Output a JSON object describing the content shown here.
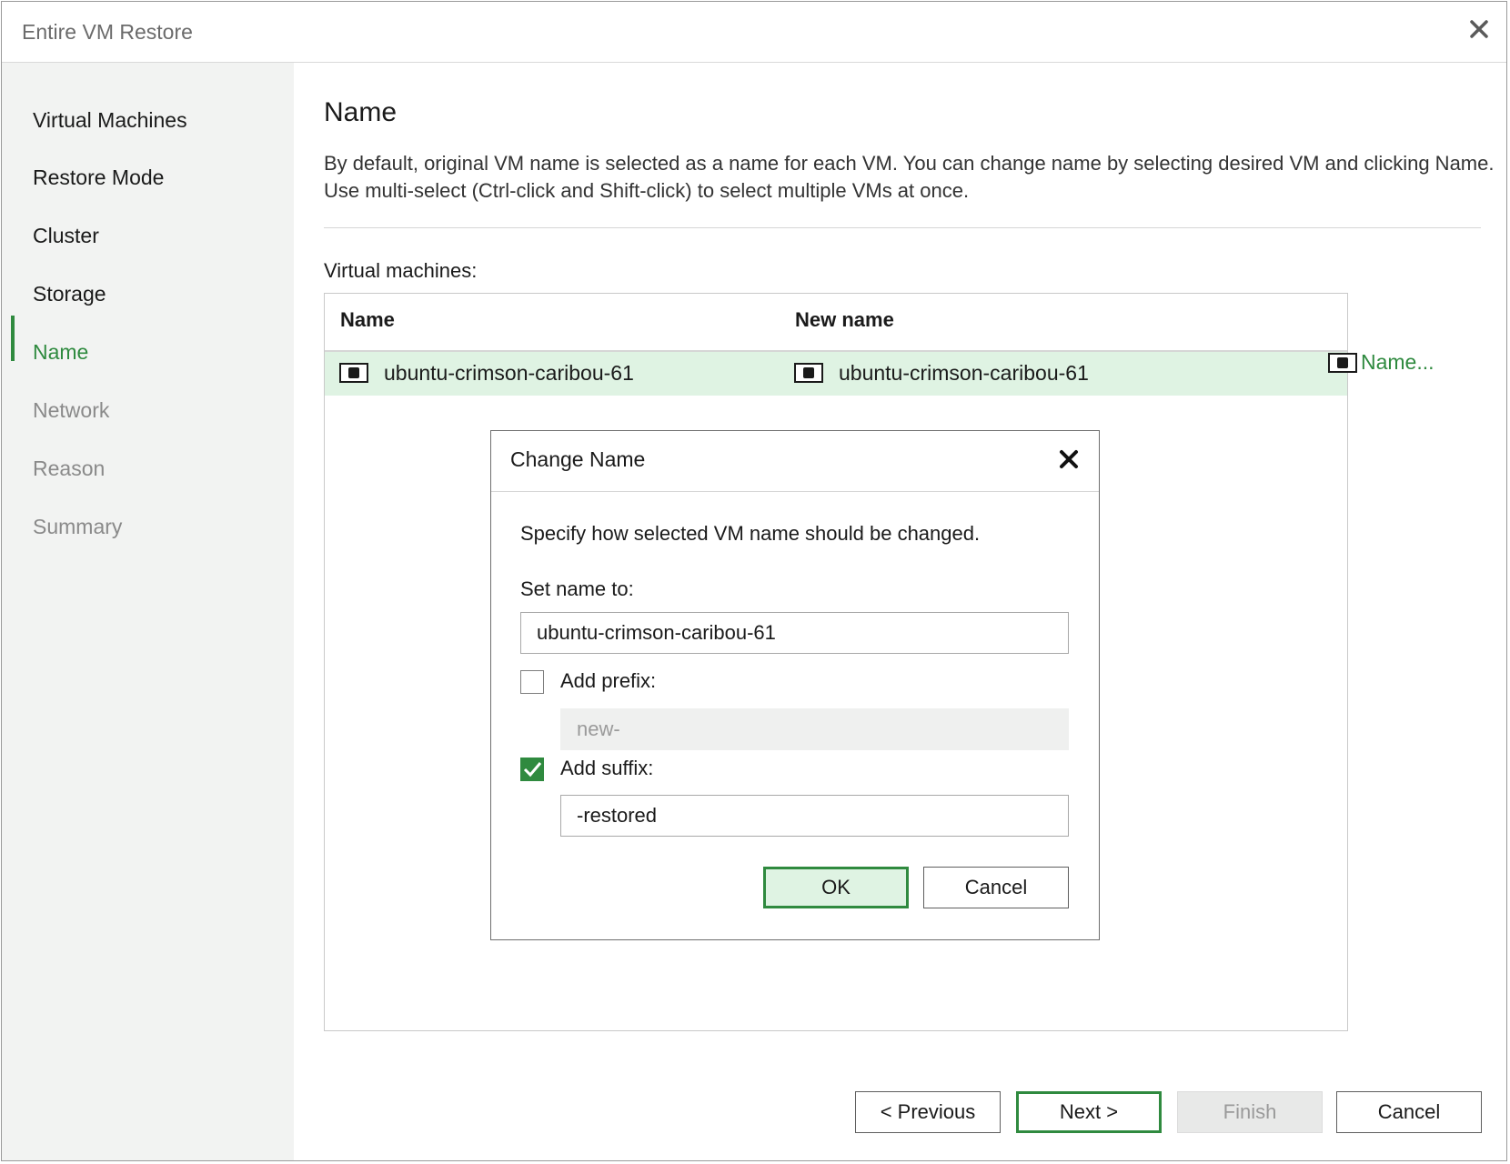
{
  "window": {
    "title": "Entire VM Restore"
  },
  "sidebar": {
    "items": [
      {
        "label": "Virtual Machines",
        "state": "done"
      },
      {
        "label": "Restore Mode",
        "state": "done"
      },
      {
        "label": "Cluster",
        "state": "done"
      },
      {
        "label": "Storage",
        "state": "done"
      },
      {
        "label": "Name",
        "state": "active"
      },
      {
        "label": "Network",
        "state": "pending"
      },
      {
        "label": "Reason",
        "state": "pending"
      },
      {
        "label": "Summary",
        "state": "pending"
      }
    ]
  },
  "main": {
    "title": "Name",
    "description": "By default, original VM name is selected as a name for each VM. You can change name by selecting desired VM and clicking Name. Use multi-select (Ctrl-click and Shift-click) to select multiple VMs at once.",
    "vm_label": "Virtual machines:",
    "table": {
      "columns": [
        "Name",
        "New name"
      ],
      "rows": [
        {
          "name": "ubuntu-crimson-caribou-61",
          "new_name": "ubuntu-crimson-caribou-61"
        }
      ]
    },
    "name_button": "Name..."
  },
  "footer": {
    "previous": "< Previous",
    "next": "Next >",
    "finish": "Finish",
    "cancel": "Cancel"
  },
  "dialog": {
    "title": "Change Name",
    "instruction": "Specify how selected VM name should be changed.",
    "set_name_label": "Set name to:",
    "set_name_value": "ubuntu-crimson-caribou-61",
    "prefix": {
      "label": "Add prefix:",
      "checked": false,
      "value": "new-"
    },
    "suffix": {
      "label": "Add suffix:",
      "checked": true,
      "value": "-restored"
    },
    "ok": "OK",
    "cancel": "Cancel"
  },
  "colors": {
    "accent": "#2f8a3f",
    "row_selected": "#dff3e3",
    "sidebar_bg": "#f2f3f2"
  },
  "icons": {
    "window_close": "close-icon",
    "vm": "vm-icon",
    "checkbox": "check-icon"
  }
}
